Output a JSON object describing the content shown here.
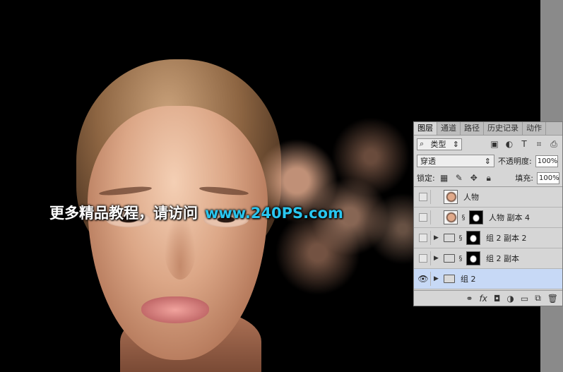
{
  "watermark": {
    "text_cn": "更多精品教程，请访问",
    "url": "www.240PS.com"
  },
  "layers_panel": {
    "tabs": [
      "图层",
      "通道",
      "路径",
      "历史记录",
      "动作"
    ],
    "filter_kind": "类型",
    "blend_mode": "穿透",
    "opacity_label": "不透明度:",
    "opacity_value": "100%",
    "lock_label": "锁定:",
    "fill_label": "填充:",
    "fill_value": "100%",
    "layers": [
      {
        "name": "人物",
        "visible": false,
        "type": "smart-object"
      },
      {
        "name": "人物 副本 4",
        "visible": false,
        "type": "smart-object-masked"
      },
      {
        "name": "组 2 副本 2",
        "visible": false,
        "type": "group-masked"
      },
      {
        "name": "组 2 副本",
        "visible": false,
        "type": "group-masked"
      },
      {
        "name": "组 2",
        "visible": true,
        "type": "group",
        "selected": true
      }
    ],
    "footer_icons": [
      "link-icon",
      "fx-icon",
      "add-mask-icon",
      "adjustment-icon",
      "new-group-icon",
      "new-layer-icon",
      "trash-icon"
    ]
  },
  "colors": {
    "watermark_url": "#29c6ef",
    "selected_layer": "#c7d9f6",
    "dust": "#e2aa8c"
  }
}
